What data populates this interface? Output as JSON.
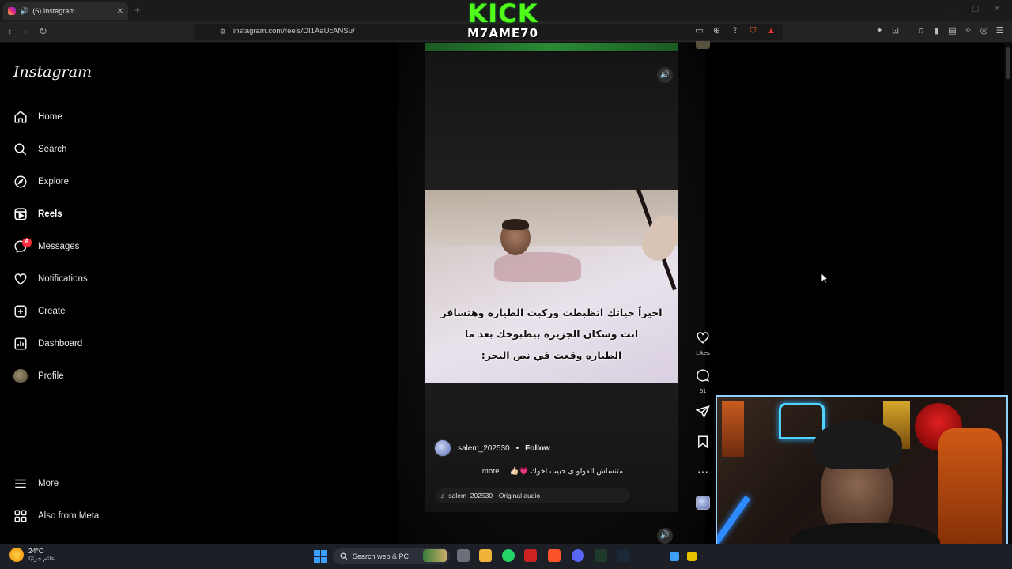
{
  "browser": {
    "tab_title": "(6) Instagram",
    "url": "instagram.com/reels/DI1AaUcANSu/"
  },
  "overlay": {
    "kick_logo": "KICK",
    "streamer_name": "M7AME70"
  },
  "sidebar": {
    "logo": "Instagram",
    "items": [
      {
        "label": "Home",
        "icon": "home-icon"
      },
      {
        "label": "Search",
        "icon": "search-icon"
      },
      {
        "label": "Explore",
        "icon": "compass-icon"
      },
      {
        "label": "Reels",
        "icon": "reels-icon",
        "active": true
      },
      {
        "label": "Messages",
        "icon": "messenger-icon",
        "badge": "6"
      },
      {
        "label": "Notifications",
        "icon": "heart-icon"
      },
      {
        "label": "Create",
        "icon": "plus-square-icon"
      },
      {
        "label": "Dashboard",
        "icon": "dashboard-icon"
      },
      {
        "label": "Profile",
        "icon": "avatar"
      }
    ],
    "more": "More",
    "meta": "Also from Meta"
  },
  "reel": {
    "caption_lines": [
      "اخيراً حياتك اتظبطت وركبت الطياره وهتسافر",
      "انت وسكان الجزيره بيطبوخك بعد ما",
      "الطياره وقعت في نص البحر:"
    ],
    "author": "salem_202530",
    "follow": "Follow",
    "description": "متنساش الفولو ى حبيب اخوك 💗👍🏻 ... more",
    "audio": "salem_202530 · Original audio",
    "likes_label": "Likes",
    "comments_count": "61"
  },
  "taskbar": {
    "temperature": "24°C",
    "weather_text": "غائم جزئيًا",
    "search_placeholder": "Search web & PC"
  },
  "colors": {
    "instagram_bg": "#000000",
    "kick_green": "#53fc18",
    "badge_red": "#ff3040"
  }
}
